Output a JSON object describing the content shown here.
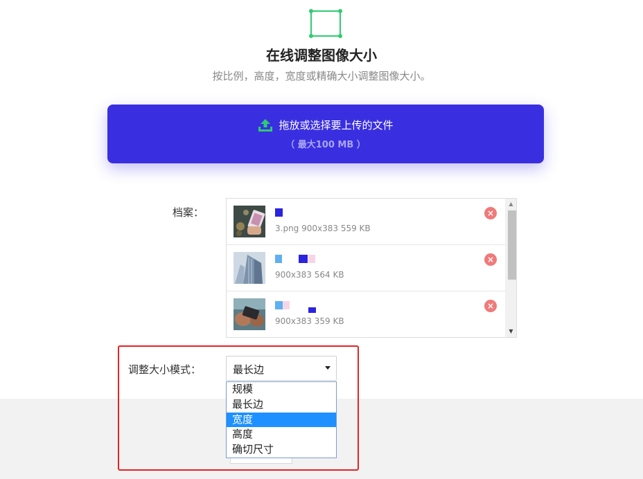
{
  "header": {
    "logo_icon": "resize-frame-icon",
    "title": "在线调整图像大小",
    "subtitle": "按比例，高度，宽度或精确大小调整图像大小。"
  },
  "upload": {
    "icon": "upload-icon",
    "label": "拖放或选择要上传的文件",
    "limit": "（ 最大100 MB ）"
  },
  "files": {
    "label": "档案：",
    "items": [
      {
        "meta": "3.png 900x383 559 KB",
        "thumb_icon": "photo-thumbnail-icon"
      },
      {
        "meta": "900x383 564 KB",
        "thumb_icon": "building-thumbnail-icon"
      },
      {
        "meta": "900x383 359 KB",
        "thumb_icon": "phone-hands-thumbnail-icon"
      }
    ],
    "remove_icon": "remove-icon"
  },
  "resize_mode": {
    "label": "调整大小模式：",
    "selected": "最长边",
    "options": [
      "规模",
      "最长边",
      "宽度",
      "高度",
      "确切尺寸"
    ],
    "highlighted_option": "宽度"
  },
  "colors": {
    "accent": "#3a2fe0",
    "logo_green": "#2ecc71",
    "remove_red": "#f07a7a",
    "highlight_red": "#e52222",
    "dropdown_selected": "#1e90ff"
  }
}
